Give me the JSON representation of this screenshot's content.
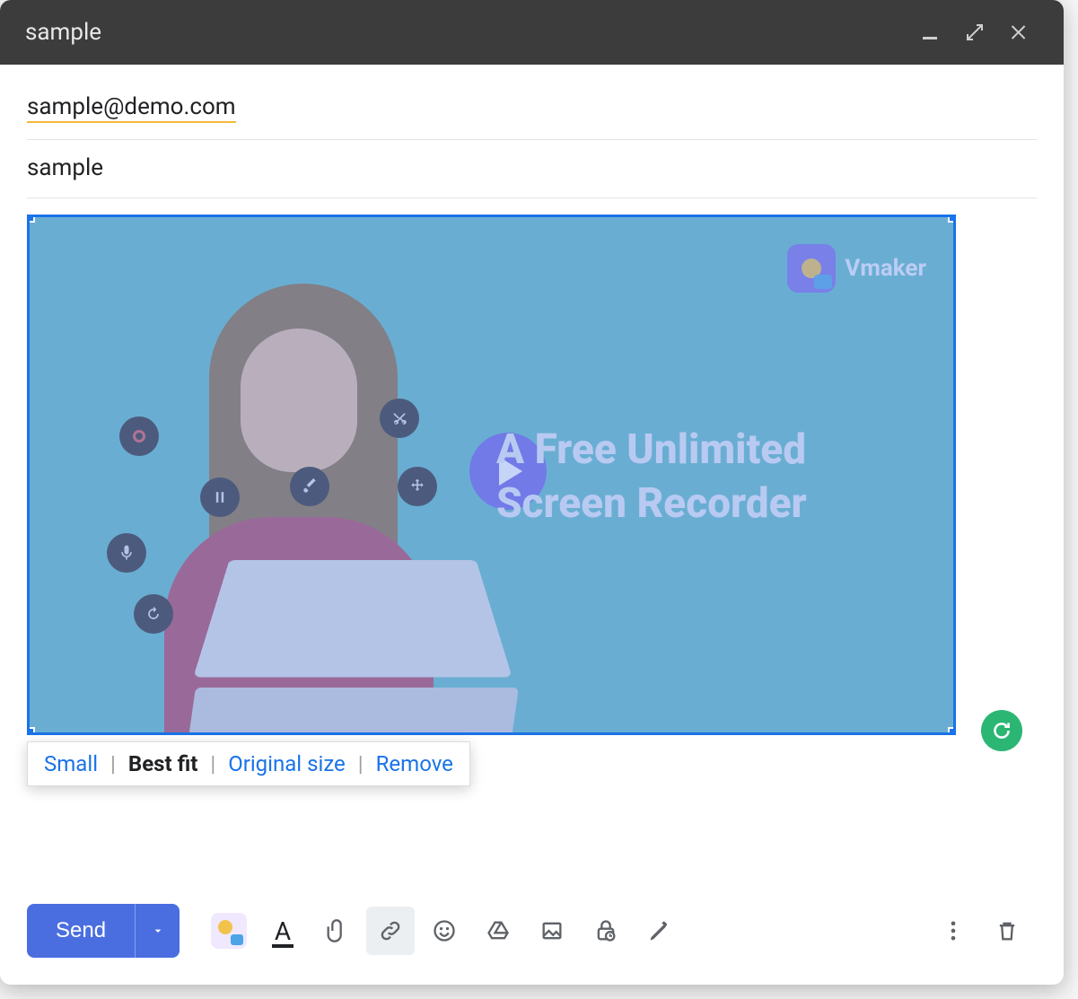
{
  "title": "sample",
  "recipient": "sample@demo.com",
  "subject": "sample",
  "thumbnail": {
    "brand": "Vmaker",
    "headline_line1": "A Free Unlimited",
    "headline_line2": "Screen Recorder"
  },
  "image_toolbar": {
    "small": "Small",
    "best_fit": "Best fit",
    "original": "Original size",
    "remove": "Remove"
  },
  "bottom": {
    "send": "Send"
  }
}
